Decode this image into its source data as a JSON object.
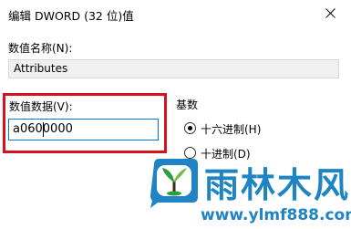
{
  "window": {
    "title": "编辑 DWORD (32 位)值"
  },
  "value_name": {
    "label": "数值名称(N):",
    "value": "Attributes"
  },
  "value_data": {
    "label": "数值数据(V):",
    "value": "a0600000"
  },
  "base": {
    "label": "基数",
    "options": [
      {
        "label": "十六进制(H)",
        "selected": true
      },
      {
        "label": "十进制(D)",
        "selected": false
      }
    ]
  },
  "watermark": {
    "title": "雨林木风",
    "url": "www.ylmf888.com"
  },
  "colors": {
    "highlight": "#d3131d",
    "focus_border": "#0078d7",
    "watermark": "#1e84c4"
  },
  "icons": {
    "close": "close-icon",
    "logo": "ylmf-logo"
  }
}
